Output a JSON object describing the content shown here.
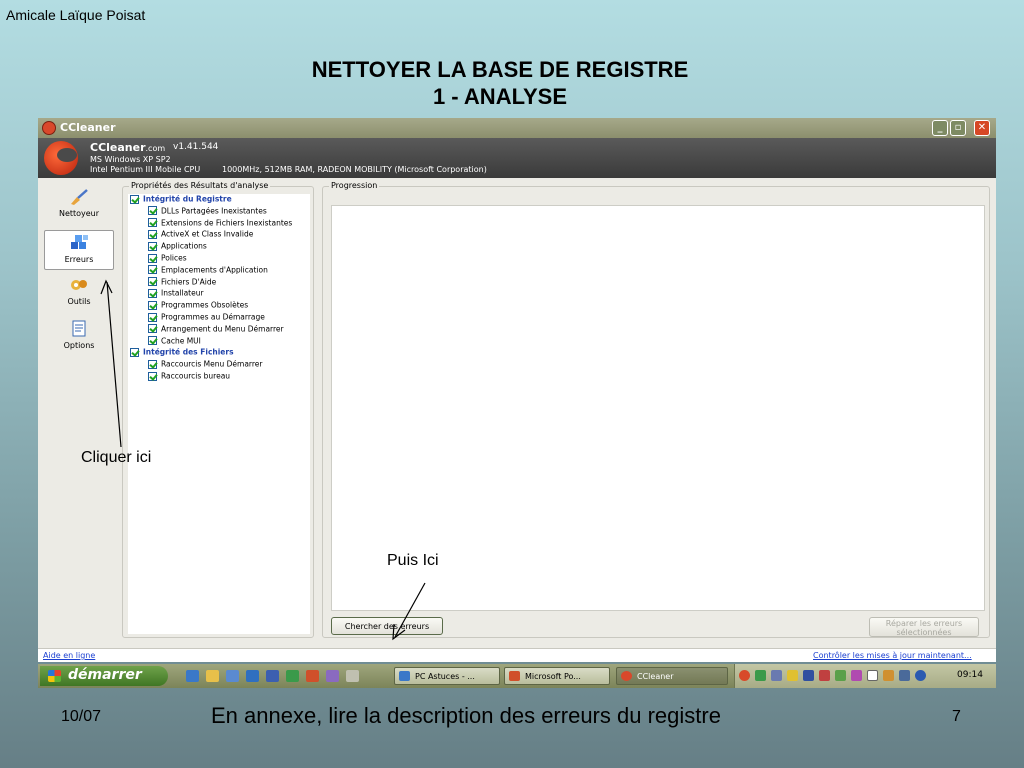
{
  "slide": {
    "header": "Amicale Laïque Poisat",
    "title_line1": "NETTOYER LA BASE DE REGISTRE",
    "title_line2": "1 - ANALYSE",
    "footer_date": "10/07",
    "footer_text": "En annexe, lire la description des erreurs du registre",
    "page_number": "7",
    "annotation_1": "Cliquer ici",
    "annotation_2": "Puis Ici"
  },
  "window": {
    "title": "CCleaner",
    "app_name": "CCleaner",
    "app_domain": ".com",
    "version": "v1.41.544",
    "os": "MS Windows XP SP2",
    "cpu": "Intel Pentium III Mobile CPU",
    "hardware": "1000MHz, 512MB RAM, RADEON MOBILITY (Microsoft Corporation)"
  },
  "nav": {
    "items": [
      {
        "label": "Nettoyeur",
        "icon": "broom-icon"
      },
      {
        "label": "Erreurs",
        "icon": "registry-cubes-icon",
        "active": true
      },
      {
        "label": "Outils",
        "icon": "tools-icon"
      },
      {
        "label": "Options",
        "icon": "options-icon"
      }
    ]
  },
  "properties": {
    "legend": "Propriétés des Résultats d'analyse",
    "items": [
      {
        "label": "Intégrité du Registre",
        "level": 0,
        "checked": true
      },
      {
        "label": "DLLs Partagées Inexistantes",
        "level": 1,
        "checked": true
      },
      {
        "label": "Extensions de Fichiers Inexistantes",
        "level": 1,
        "checked": true
      },
      {
        "label": "ActiveX et Class Invalide",
        "level": 1,
        "checked": true
      },
      {
        "label": "Applications",
        "level": 1,
        "checked": true
      },
      {
        "label": "Polices",
        "level": 1,
        "checked": true
      },
      {
        "label": "Emplacements d'Application",
        "level": 1,
        "checked": true
      },
      {
        "label": "Fichiers D'Aide",
        "level": 1,
        "checked": true
      },
      {
        "label": "Installateur",
        "level": 1,
        "checked": true
      },
      {
        "label": "Programmes Obsolètes",
        "level": 1,
        "checked": true
      },
      {
        "label": "Programmes au Démarrage",
        "level": 1,
        "checked": true
      },
      {
        "label": "Arrangement du Menu Démarrer",
        "level": 1,
        "checked": true
      },
      {
        "label": "Cache MUI",
        "level": 1,
        "checked": true
      },
      {
        "label": "Intégrité des Fichiers",
        "level": 0,
        "checked": true
      },
      {
        "label": "Raccourcis Menu Démarrer",
        "level": 1,
        "checked": true
      },
      {
        "label": "Raccourcis bureau",
        "level": 1,
        "checked": true
      }
    ]
  },
  "progress": {
    "legend": "Progression",
    "scan_button": "Chercher des erreurs",
    "repair_button_line1": "Réparer les erreurs",
    "repair_button_line2": "sélectionnées"
  },
  "status": {
    "help_link": "Aide en ligne",
    "update_link": "Contrôler les mises à jour maintenant..."
  },
  "taskbar": {
    "start_label": "démarrer",
    "tasks": [
      {
        "label": "PC Astuces - ...",
        "icon": "ie-icon"
      },
      {
        "label": "Microsoft Po...",
        "icon": "powerpoint-icon"
      },
      {
        "label": "CCleaner",
        "icon": "ccleaner-icon",
        "active": true
      }
    ],
    "clock": "09:14"
  },
  "colors": {
    "accent_link": "#1a3fd1",
    "tree_heading": "#2244aa",
    "checkmark": "#21a121"
  }
}
